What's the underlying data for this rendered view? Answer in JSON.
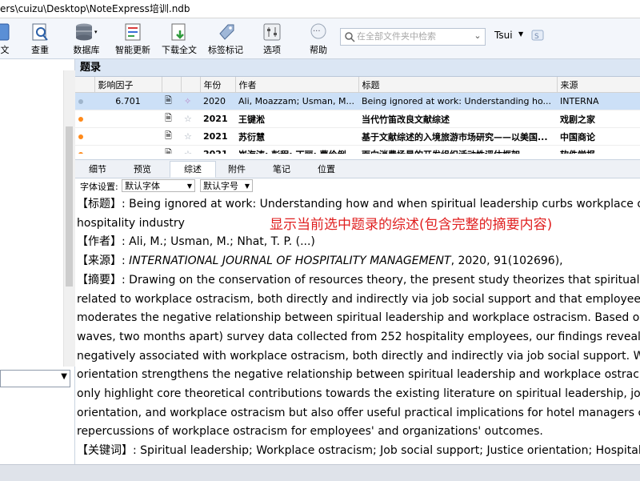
{
  "window": {
    "title": "ers\\cuizu\\Desktop\\NoteExpress培训.ndb"
  },
  "toolbar": {
    "buttons": [
      {
        "label": "文",
        "icon": "document-icon"
      },
      {
        "label": "查重",
        "icon": "find-duplicates-icon"
      },
      {
        "label": "数据库",
        "icon": "database-icon"
      },
      {
        "label": "智能更新",
        "icon": "smart-update-icon"
      },
      {
        "label": "下载全文",
        "icon": "download-fulltext-icon"
      },
      {
        "label": "标签标记",
        "icon": "tag-icon"
      },
      {
        "label": "选项",
        "icon": "options-icon"
      },
      {
        "label": "帮助",
        "icon": "help-icon"
      }
    ],
    "search_placeholder": "在全部文件夹中检索",
    "user": "Tsui"
  },
  "references": {
    "header": "题录",
    "columns": [
      "影响因子",
      "",
      "",
      "年份",
      "作者",
      "标题",
      "来源"
    ],
    "rows": [
      {
        "impact": "6.701",
        "year": "2020",
        "author": "Ali, Moazzam; Usman, M...",
        "title": "Being ignored at work: Understanding ho...",
        "source": "INTERNA"
      },
      {
        "impact": "",
        "year": "2021",
        "author": "王键淞",
        "title": "当代竹笛改良文献综述",
        "source": "戏剧之家"
      },
      {
        "impact": "",
        "year": "2021",
        "author": "苏衍慧",
        "title": "基于文献综述的入境旅游市场研究——以美国...",
        "source": "中国商论"
      },
      {
        "impact": "",
        "year": "2021",
        "author": "崔海涛; 彭程; 丁丽; 曹伶俐",
        "title": "面向消费场景的开发组织活动性评估框架",
        "source": "软件学报"
      }
    ]
  },
  "detail": {
    "tabs": [
      "细节",
      "预览",
      "综述",
      "附件",
      "笔记",
      "位置"
    ],
    "active_tab": "综述",
    "font_label": "字体设置:",
    "font_value": "默认字体",
    "size_value": "默认字号",
    "lines": {
      "title": "【标题】: Being ignored at work: Understanding how and when spiritual leadership curbs workplace ostr",
      "title2": "hospitality industry",
      "author": "【作者】: Ali, M.; Usman, M.; Nhat, T. P. (...)",
      "source_prefix": "【来源】: ",
      "source_journal": "INTERNATIONAL JOURNAL OF HOSPITALITY MANAGEMENT",
      "source_suffix": ", 2020, 91(102696),",
      "abstract": [
        "【摘要】: Drawing on the conservation of resources theory, the present study theorizes that spiritual lea",
        "related to workplace ostracism, both directly and indirectly via job social support and that employees' jus",
        "moderates the negative relationship between spiritual leadership and workplace ostracism. Based on tim",
        "waves, two months apart) survey data collected from 252 hospitality employees, our findings reveal that",
        "negatively associated with workplace ostracism, both directly and indirectly via job social support. We als",
        "orientation strengthens the negative relationship between spiritual leadership and workplace ostracism.",
        "only highlight core theoretical contributions towards the existing literature on spiritual leadership, job soc",
        "orientation, and workplace ostracism but also offer useful practical implications for hotel managers conc",
        "repercussions of workplace ostracism for employees' and organizations' outcomes."
      ],
      "keywords": "【关键词】: Spiritual leadership; Workplace ostracism; Job social support; Justice orientation; Hospitality"
    },
    "annotation": "显示当前选中题录的综述(包含完整的摘要内容)"
  },
  "colors": {
    "accent": "#cce0f7",
    "annotation": "#e02020",
    "dot_orange": "#ff8a1a"
  }
}
